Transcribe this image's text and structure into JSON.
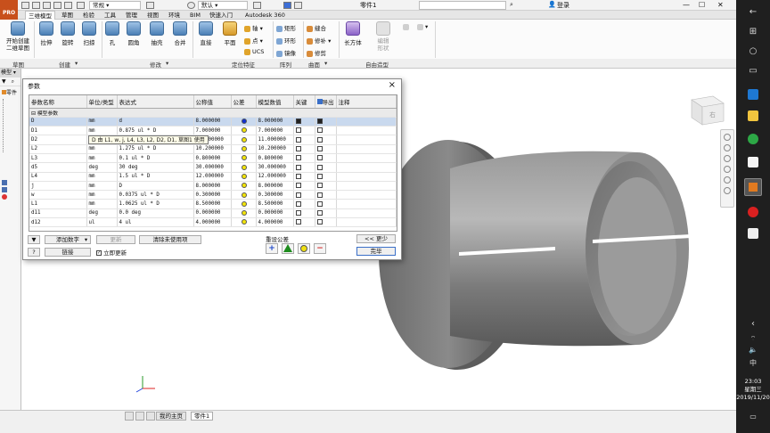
{
  "titlebar": {
    "app_logo": "PRO",
    "style_value": "常规",
    "material_value": "默认",
    "doc_title": "零件1",
    "login": "登录"
  },
  "tabs": [
    "三维模型",
    "草图",
    "检验",
    "工具",
    "管理",
    "视图",
    "环境",
    "BIM",
    "快速入门",
    "Autodesk 360"
  ],
  "ribbon": {
    "sketch_button": "开始创建\n二维草图",
    "create": [
      "拉伸",
      "旋转",
      "扫掠",
      "孔",
      "圆角",
      "抽壳",
      "合并",
      "直接",
      "平面"
    ],
    "axis_items": [
      "轴",
      "点",
      "UCS"
    ],
    "pattern_items": [
      "矩形",
      "环形",
      "镜像"
    ],
    "surface_items": [
      "缝合",
      "修补",
      "修剪"
    ],
    "box_button": "长方体",
    "edit_form": "编辑\n形状",
    "groups": [
      "草图",
      "创建",
      "修改",
      "定位特征",
      "阵列",
      "曲面",
      "自由造型"
    ]
  },
  "browser": {
    "header": "模型",
    "items": [
      "零件"
    ]
  },
  "dialog": {
    "title": "参数",
    "columns": [
      "参数名称",
      "单位/类型",
      "表达式",
      "公称值",
      "公差",
      "模型数值",
      "关键",
      "导出",
      "注释"
    ],
    "group_label": "模型参数",
    "rows": [
      {
        "name": "D",
        "unit": "mm",
        "expr": "d",
        "nominal": "8.000000",
        "model": "8.000000",
        "key": true,
        "exp": true,
        "sel": true,
        "tol": "blue"
      },
      {
        "name": "D1",
        "unit": "mm",
        "expr": "0.875 ul * D",
        "nominal": "7.000000",
        "model": "7.000000",
        "key": false,
        "exp": false,
        "tol": "yellow"
      },
      {
        "name": "D2",
        "unit": "mm",
        "expr": "",
        "nominal": "11.000000",
        "model": "11.000000",
        "key": false,
        "exp": false,
        "tol": "yellow"
      },
      {
        "name": "L2",
        "unit": "mm",
        "expr": "1.275 ul * D",
        "nominal": "10.200000",
        "model": "10.200000",
        "key": false,
        "exp": false,
        "tol": "yellow"
      },
      {
        "name": "L3",
        "unit": "mm",
        "expr": "0.1 ul * D",
        "nominal": "0.800000",
        "model": "0.800000",
        "key": false,
        "exp": false,
        "tol": "yellow"
      },
      {
        "name": "d5",
        "unit": "deg",
        "expr": "30 deg",
        "nominal": "30.000000",
        "model": "30.000000",
        "key": false,
        "exp": false,
        "tol": "yellow"
      },
      {
        "name": "L4",
        "unit": "mm",
        "expr": "1.5 ul * D",
        "nominal": "12.000000",
        "model": "12.000000",
        "key": false,
        "exp": false,
        "tol": "yellow"
      },
      {
        "name": "j",
        "unit": "mm",
        "expr": "D",
        "nominal": "8.000000",
        "model": "8.000000",
        "key": false,
        "exp": false,
        "tol": "yellow"
      },
      {
        "name": "w",
        "unit": "mm",
        "expr": "0.0375 ul * D",
        "nominal": "0.300000",
        "model": "0.300000",
        "key": false,
        "exp": false,
        "tol": "yellow"
      },
      {
        "name": "L1",
        "unit": "mm",
        "expr": "1.0625 ul * D",
        "nominal": "8.500000",
        "model": "8.500000",
        "key": false,
        "exp": false,
        "tol": "yellow"
      },
      {
        "name": "d11",
        "unit": "deg",
        "expr": "0.0 deg",
        "nominal": "0.000000",
        "model": "0.000000",
        "key": false,
        "exp": false,
        "tol": "yellow"
      },
      {
        "name": "d12",
        "unit": "ul",
        "expr": "4 ul",
        "nominal": "4.000000",
        "model": "4.000000",
        "key": false,
        "exp": false,
        "tol": "yellow"
      }
    ],
    "tooltip": "D 由 L1, w, j, L4, L3, L2, D2, D1, 草图1 使用",
    "add_number": "添加数字",
    "update": "更新",
    "purge": "清除未使用项",
    "link": "链接",
    "immediate_update": "立即更新",
    "reset_tolerance": "重设公差",
    "less": "<< 更少",
    "done": "完毕"
  },
  "doc_tabs": [
    "我的主页",
    "零件1"
  ],
  "taskbar": {
    "ime": "中",
    "time": "23:03",
    "weekday": "星期三",
    "date": "2019/11/20"
  },
  "colors": {
    "tol_blue": "#1030d0",
    "tol_yellow": "#f2e40a",
    "plus": "#1d47c9",
    "triangle": "#1e8c1e",
    "circle": "#f0e010",
    "minus": "#d42a2a"
  }
}
